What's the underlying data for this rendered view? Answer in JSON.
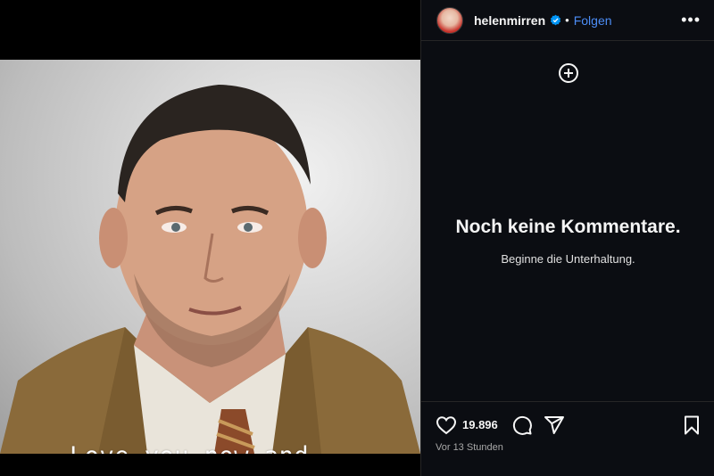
{
  "post": {
    "overlay_text": "Love you now and\nalways helen",
    "image_alt": "portrait photo of a man in a tan jacket"
  },
  "sidebar": {
    "username": "helenmirren",
    "separator": "•",
    "follow_label": "Folgen",
    "more_label": "•••",
    "empty_title": "Noch keine Kommentare.",
    "empty_subtitle": "Beginne die Unterhaltung.",
    "likes": "19.896",
    "timestamp": "Vor 13 Stunden"
  },
  "icons": {
    "verified": "verified-badge-icon",
    "add": "plus-circle-icon",
    "like": "heart-icon",
    "comment": "comment-bubble-icon",
    "share": "paper-plane-icon",
    "save": "bookmark-icon"
  },
  "colors": {
    "accent": "#4c8df6",
    "sidebar_bg": "#0b0d12",
    "text": "#f5f5f5",
    "muted": "#a8a8a8"
  }
}
